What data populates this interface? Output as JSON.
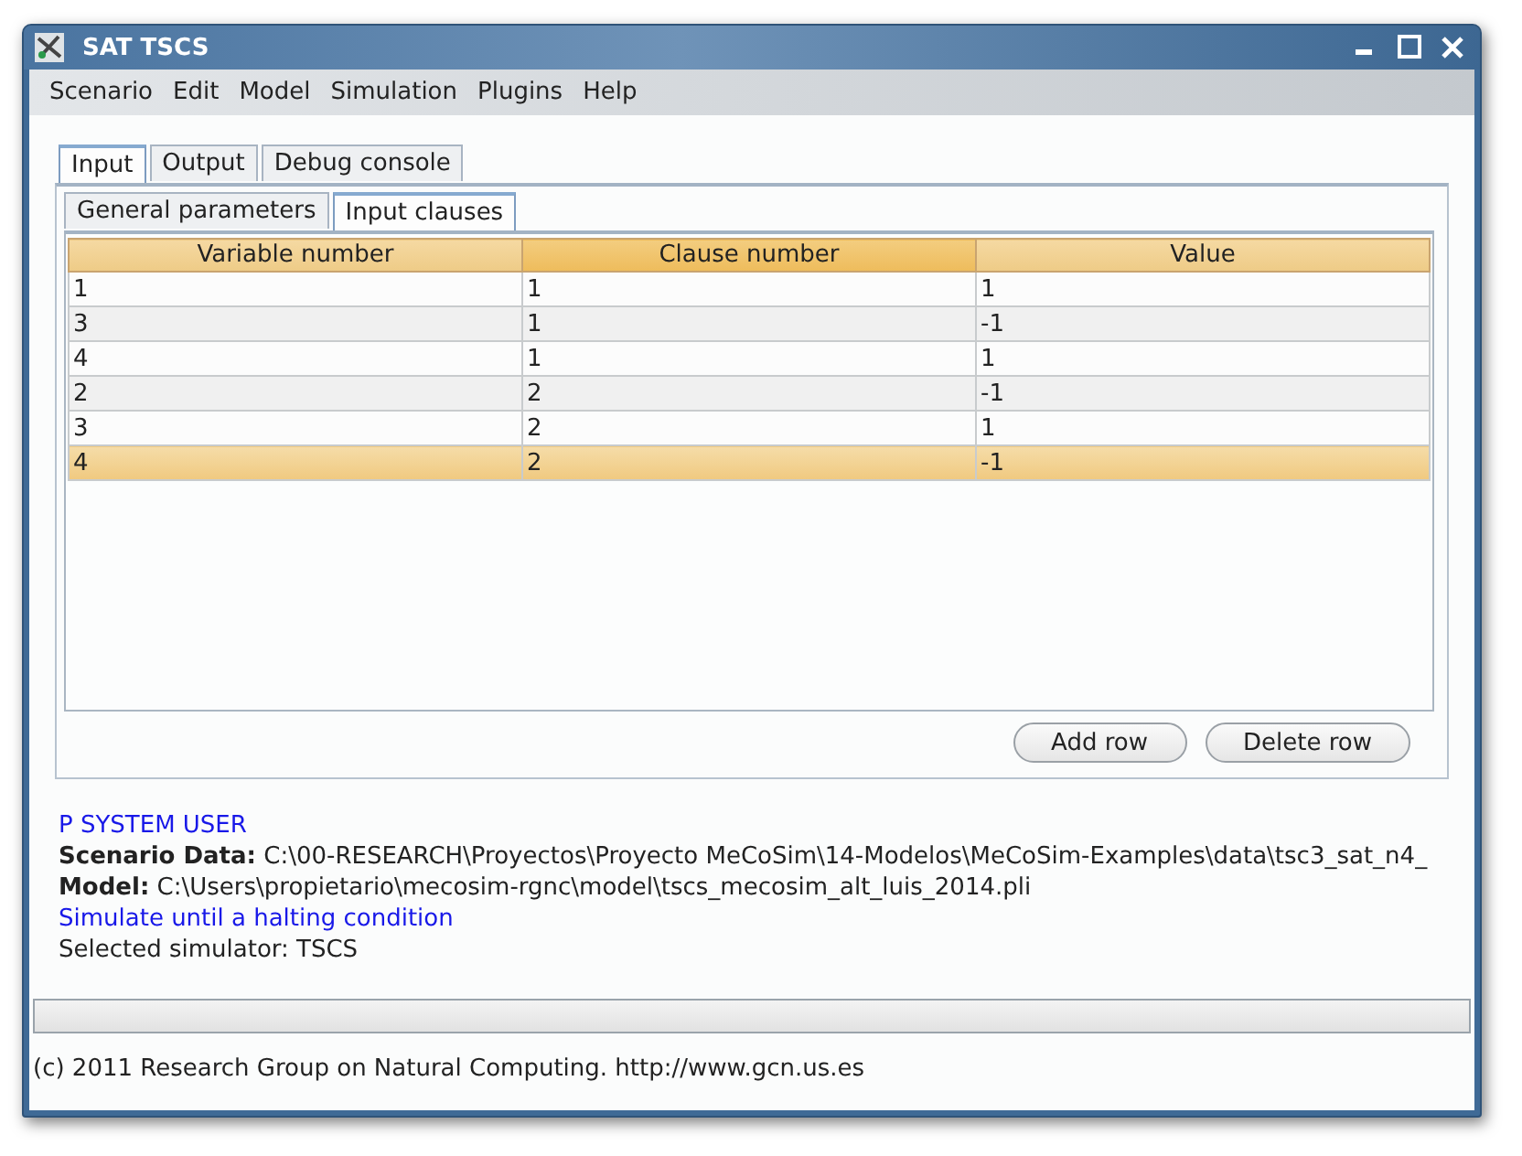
{
  "window": {
    "title": "SAT TSCS"
  },
  "menu": [
    "Scenario",
    "Edit",
    "Model",
    "Simulation",
    "Plugins",
    "Help"
  ],
  "tabs": [
    {
      "label": "Input",
      "selected": true
    },
    {
      "label": "Output",
      "selected": false
    },
    {
      "label": "Debug console",
      "selected": false
    }
  ],
  "subtabs": [
    {
      "label": "General parameters",
      "selected": false
    },
    {
      "label": "Input clauses",
      "selected": true
    }
  ],
  "table": {
    "columns": [
      {
        "label": "Variable number",
        "selected": false
      },
      {
        "label": "Clause number",
        "selected": true
      },
      {
        "label": "Value",
        "selected": false
      }
    ],
    "rows": [
      {
        "cells": [
          "1",
          "1",
          "1"
        ],
        "selected": false
      },
      {
        "cells": [
          "3",
          "1",
          "-1"
        ],
        "selected": false
      },
      {
        "cells": [
          "4",
          "1",
          "1"
        ],
        "selected": false
      },
      {
        "cells": [
          "2",
          "2",
          "-1"
        ],
        "selected": false
      },
      {
        "cells": [
          "3",
          "2",
          "1"
        ],
        "selected": false
      },
      {
        "cells": [
          "4",
          "2",
          "-1"
        ],
        "selected": true
      }
    ]
  },
  "buttons": [
    "Add row",
    "Delete row"
  ],
  "log": [
    {
      "kind": "info",
      "text": "P SYSTEM USER"
    },
    {
      "kind": "labeled",
      "label": "Scenario Data:",
      "text": "C:\\00-RESEARCH\\Proyectos\\Proyecto MeCoSim\\14-Modelos\\MeCoSim-Examples\\data\\tsc3_sat_n4_"
    },
    {
      "kind": "labeled",
      "label": "Model:",
      "text": "C:\\Users\\propietario\\mecosim-rgnc\\model\\tscs_mecosim_alt_luis_2014.pli"
    },
    {
      "kind": "info",
      "text": "Simulate until a halting condition"
    },
    {
      "kind": "plain",
      "text": "Selected simulator: TSCS"
    }
  ],
  "progress": {
    "level": 0
  },
  "status_bar": "(c) 2011 Research Group on Natural Computing. http://www.gcn.us.es"
}
